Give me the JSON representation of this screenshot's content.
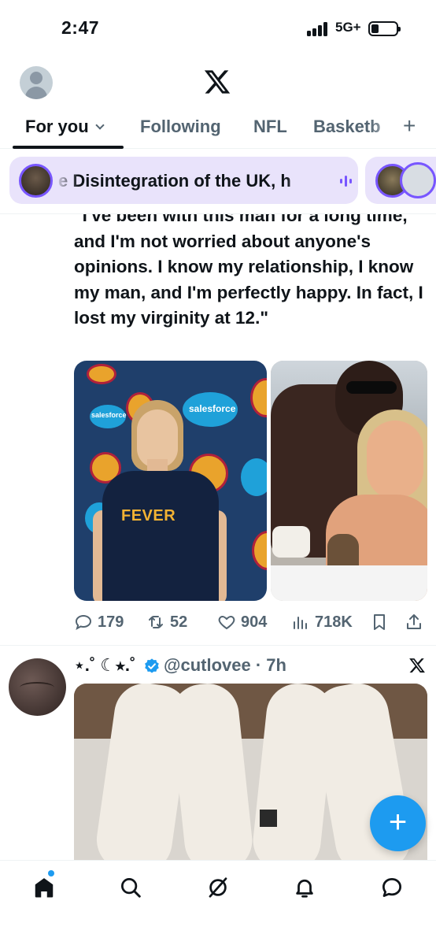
{
  "status_bar": {
    "time": "2:47",
    "network": "5G+"
  },
  "header": {
    "logo_icon": "x-logo-icon"
  },
  "tabs": [
    {
      "label": "For you",
      "active": true
    },
    {
      "label": "Following",
      "active": false
    },
    {
      "label": "NFL",
      "active": false
    },
    {
      "label": "Basketb",
      "active": false
    }
  ],
  "tabs_add_label": "+",
  "spaces": {
    "live_title": "e Disintegration of the UK, h"
  },
  "tweet1": {
    "text": "\"I've been with this man for a long time, and I'm not worried about anyone's opinions. I know my relationship, I know my man, and I'm perfectly happy. In fact, I lost my virginity at 12.\"",
    "media": {
      "photo1_text_fever": "FEVER",
      "photo1_brand": "salesforce"
    },
    "stats": {
      "replies": "179",
      "reposts": "52",
      "likes": "904",
      "views": "718K"
    }
  },
  "tweet2": {
    "display_name": "⋆.˚ ☾⭒.˚",
    "handle_time": "@cutlovee · 7h"
  },
  "fab_label": "+",
  "colors": {
    "accent": "#1d9bf0",
    "spaces_purple": "#7856ff",
    "spaces_bg": "#e9e3fb",
    "text_primary": "#0f1419",
    "text_secondary": "#536471"
  }
}
